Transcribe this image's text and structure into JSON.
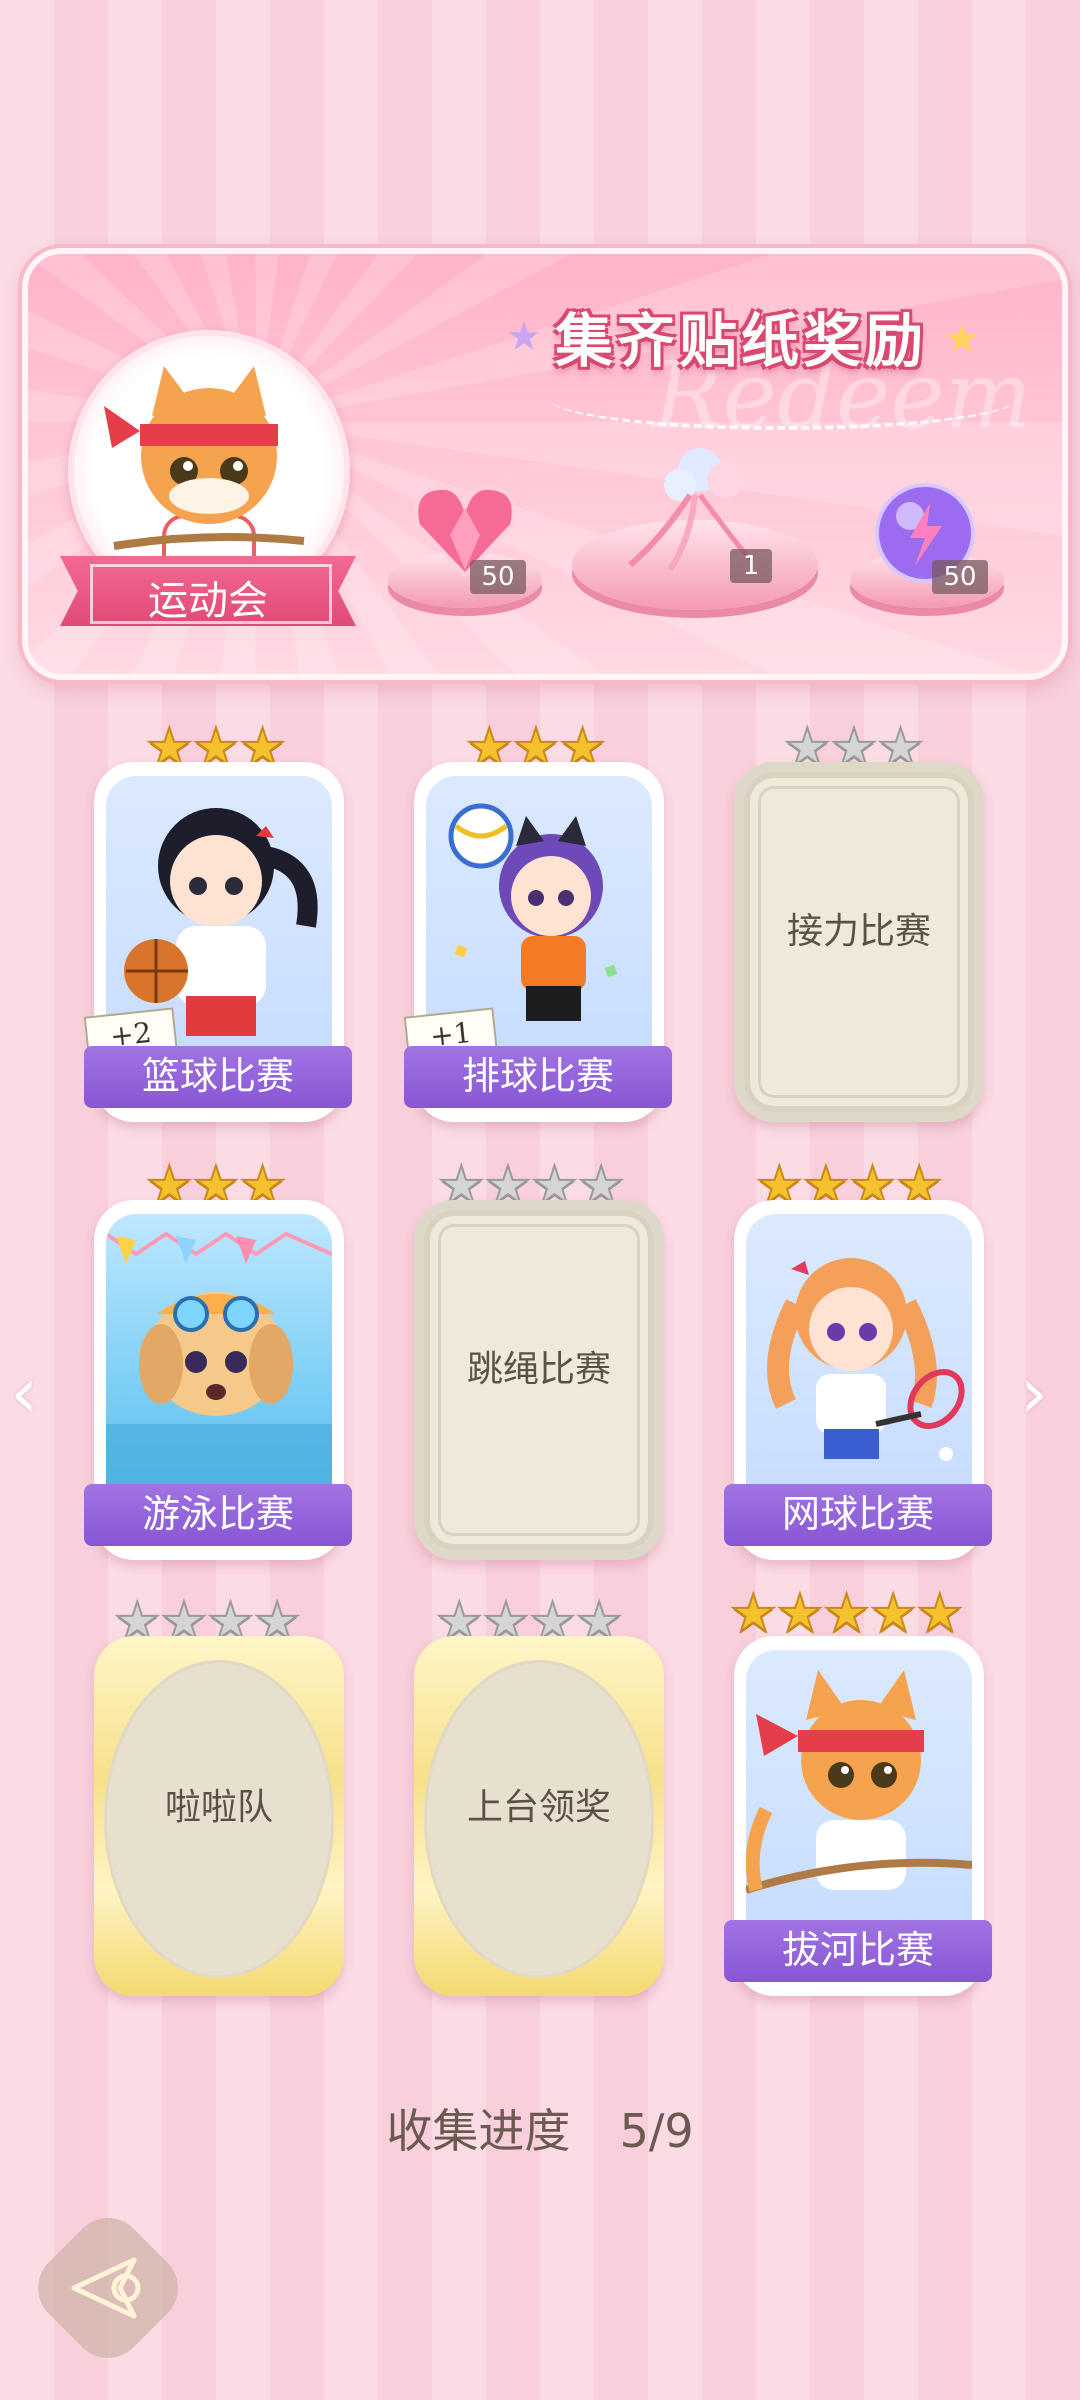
{
  "banner": {
    "title": "集齐贴纸奖励",
    "watermark": "Redeem",
    "event_label": "运动会",
    "rewards": [
      {
        "item": "pink-heart-gem-icon",
        "count": "50"
      },
      {
        "item": "ribbon-bouquet-icon",
        "count": "1"
      },
      {
        "item": "purple-lightning-orb-icon",
        "count": "50"
      }
    ]
  },
  "stickers": [
    {
      "name": "篮球比赛",
      "collected": true,
      "stars_total": 3,
      "stars_filled": 3,
      "bonus": "+2"
    },
    {
      "name": "排球比赛",
      "collected": true,
      "stars_total": 3,
      "stars_filled": 3,
      "bonus": "+1"
    },
    {
      "name": "接力比赛",
      "collected": false,
      "stars_total": 3,
      "stars_filled": 0
    },
    {
      "name": "游泳比赛",
      "collected": true,
      "stars_total": 3,
      "stars_filled": 3
    },
    {
      "name": "跳绳比赛",
      "collected": false,
      "stars_total": 4,
      "stars_filled": 0
    },
    {
      "name": "网球比赛",
      "collected": true,
      "stars_total": 4,
      "stars_filled": 4
    },
    {
      "name": "啦啦队",
      "collected": false,
      "stars_total": 4,
      "stars_filled": 0
    },
    {
      "name": "上台领奖",
      "collected": false,
      "stars_total": 4,
      "stars_filled": 0
    },
    {
      "name": "拔河比赛",
      "collected": true,
      "stars_total": 5,
      "stars_filled": 5
    }
  ],
  "progress": {
    "label": "收集进度",
    "value": "5/9"
  },
  "colors": {
    "label_purple": "#8856d4",
    "gold_star": "#f6c12f",
    "pink_banner": "#ffb3c8"
  }
}
